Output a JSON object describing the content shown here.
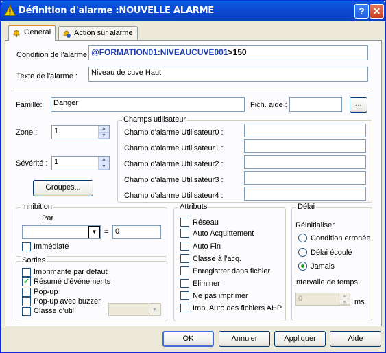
{
  "window": {
    "title": "Définition d'alarme :NOUVELLE ALARME",
    "help_glyph": "?",
    "close_glyph": "✕"
  },
  "tabs": [
    {
      "label": "General",
      "icon": "alarm-bell-icon"
    },
    {
      "label": "Action sur alarme",
      "icon": "alarm-action-icon"
    }
  ],
  "condition": {
    "label": "Condition de l'alarme :",
    "expression_var": "@FORMATION01:NIVEAUCUVE001",
    "expression_rest": ">150"
  },
  "texte": {
    "label": "Texte de l'alarme :",
    "value": "Niveau de cuve Haut"
  },
  "famille": {
    "label": "Famille:",
    "value": "Danger"
  },
  "fich_aide": {
    "label": "Fich. aide :",
    "value": "",
    "browse_label": "..."
  },
  "zone": {
    "label": "Zone :",
    "value": "1"
  },
  "severite": {
    "label": "Sévérité :",
    "value": "1"
  },
  "groupes_button": "Groupes...",
  "champs": {
    "legend": "Champs utilisateur",
    "fields": [
      {
        "label": "Champ d'alarme Utilisateur0 :",
        "value": ""
      },
      {
        "label": "Champ d'alarme Utilisateur1 :",
        "value": ""
      },
      {
        "label": "Champ d'alarme Utilisateur2 :",
        "value": ""
      },
      {
        "label": "Champ d'alarme Utilisateur3 :",
        "value": ""
      },
      {
        "label": "Champ d'alarme Utilisateur4 :",
        "value": ""
      }
    ]
  },
  "inhibition": {
    "legend": "Inhibition",
    "par_label": "Par",
    "par_value": "",
    "equals": "=",
    "value": "0",
    "immediate_label": "Immédiate",
    "immediate_checked": false
  },
  "sorties": {
    "legend": "Sorties",
    "items": [
      {
        "label": "Imprimante par défaut",
        "checked": false
      },
      {
        "label": "Résumé d'événements",
        "checked": true
      },
      {
        "label": "Pop-up",
        "checked": false
      },
      {
        "label": "Pop-up avec buzzer",
        "checked": false
      },
      {
        "label": "Classe d'util.",
        "checked": false
      }
    ],
    "classe_value": ""
  },
  "attributs": {
    "legend": "Attributs",
    "items": [
      {
        "label": "Réseau",
        "checked": false
      },
      {
        "label": "Auto Acquittement",
        "checked": false
      },
      {
        "label": "Auto Fin",
        "checked": false
      },
      {
        "label": "Classe à l'acq.",
        "checked": false
      },
      {
        "label": "Enregistrer dans fichier",
        "checked": false
      },
      {
        "label": "Eliminer",
        "checked": false
      },
      {
        "label": "Ne pas imprimer",
        "checked": false
      },
      {
        "label": "Imp. Auto des fichiers AHP",
        "checked": false
      }
    ]
  },
  "delai": {
    "legend": "Délai",
    "reinit_label": "Réinitialiser",
    "options": [
      {
        "label": "Condition erronée",
        "selected": false
      },
      {
        "label": "Délai écoulé",
        "selected": false
      },
      {
        "label": "Jamais",
        "selected": true
      }
    ],
    "interval_label": "Intervalle de temps :",
    "interval_value": "0",
    "unit": "ms."
  },
  "buttons": {
    "ok": "OK",
    "annuler": "Annuler",
    "appliquer": "Appliquer",
    "aide": "Aide"
  }
}
